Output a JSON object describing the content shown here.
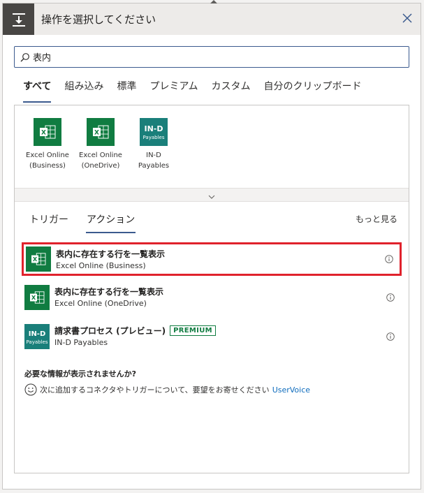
{
  "header": {
    "title": "操作を選択してください"
  },
  "search": {
    "value": "表内",
    "placeholder": ""
  },
  "tabs": [
    "すべて",
    "組み込み",
    "標準",
    "プレミアム",
    "カスタム",
    "自分のクリップボード"
  ],
  "connectors": [
    {
      "label": "Excel Online\n(Business)",
      "icon": "excel-icon"
    },
    {
      "label": "Excel Online\n(OneDrive)",
      "icon": "excel-icon"
    },
    {
      "label": "IN-D\nPayables",
      "icon": "ind-payables-icon"
    }
  ],
  "subtabs": [
    "トリガー",
    "アクション"
  ],
  "see_more": "もっと見る",
  "actions": [
    {
      "title": "表内に存在する行を一覧表示",
      "subtitle": "Excel Online (Business)",
      "highlighted": true
    },
    {
      "title": "表内に存在する行を一覧表示",
      "subtitle": "Excel Online (OneDrive)",
      "highlighted": false
    },
    {
      "title": "請求書プロセス (プレビュー)",
      "subtitle": "IN-D Payables",
      "badge": "PREMIUM",
      "highlighted": false
    }
  ],
  "ind_icon_text": {
    "brand": "IN-D",
    "name": "Payables"
  },
  "missing": {
    "title": "必要な情報が表示されませんか?",
    "text": "次に追加するコネクタやトリガーについて、要望をお寄せください",
    "link": "UserVoice"
  },
  "colors": {
    "accent": "#3b5a8e",
    "highlight": "#e0222c",
    "excel": "#107c41",
    "ind": "#1a7f7a"
  }
}
